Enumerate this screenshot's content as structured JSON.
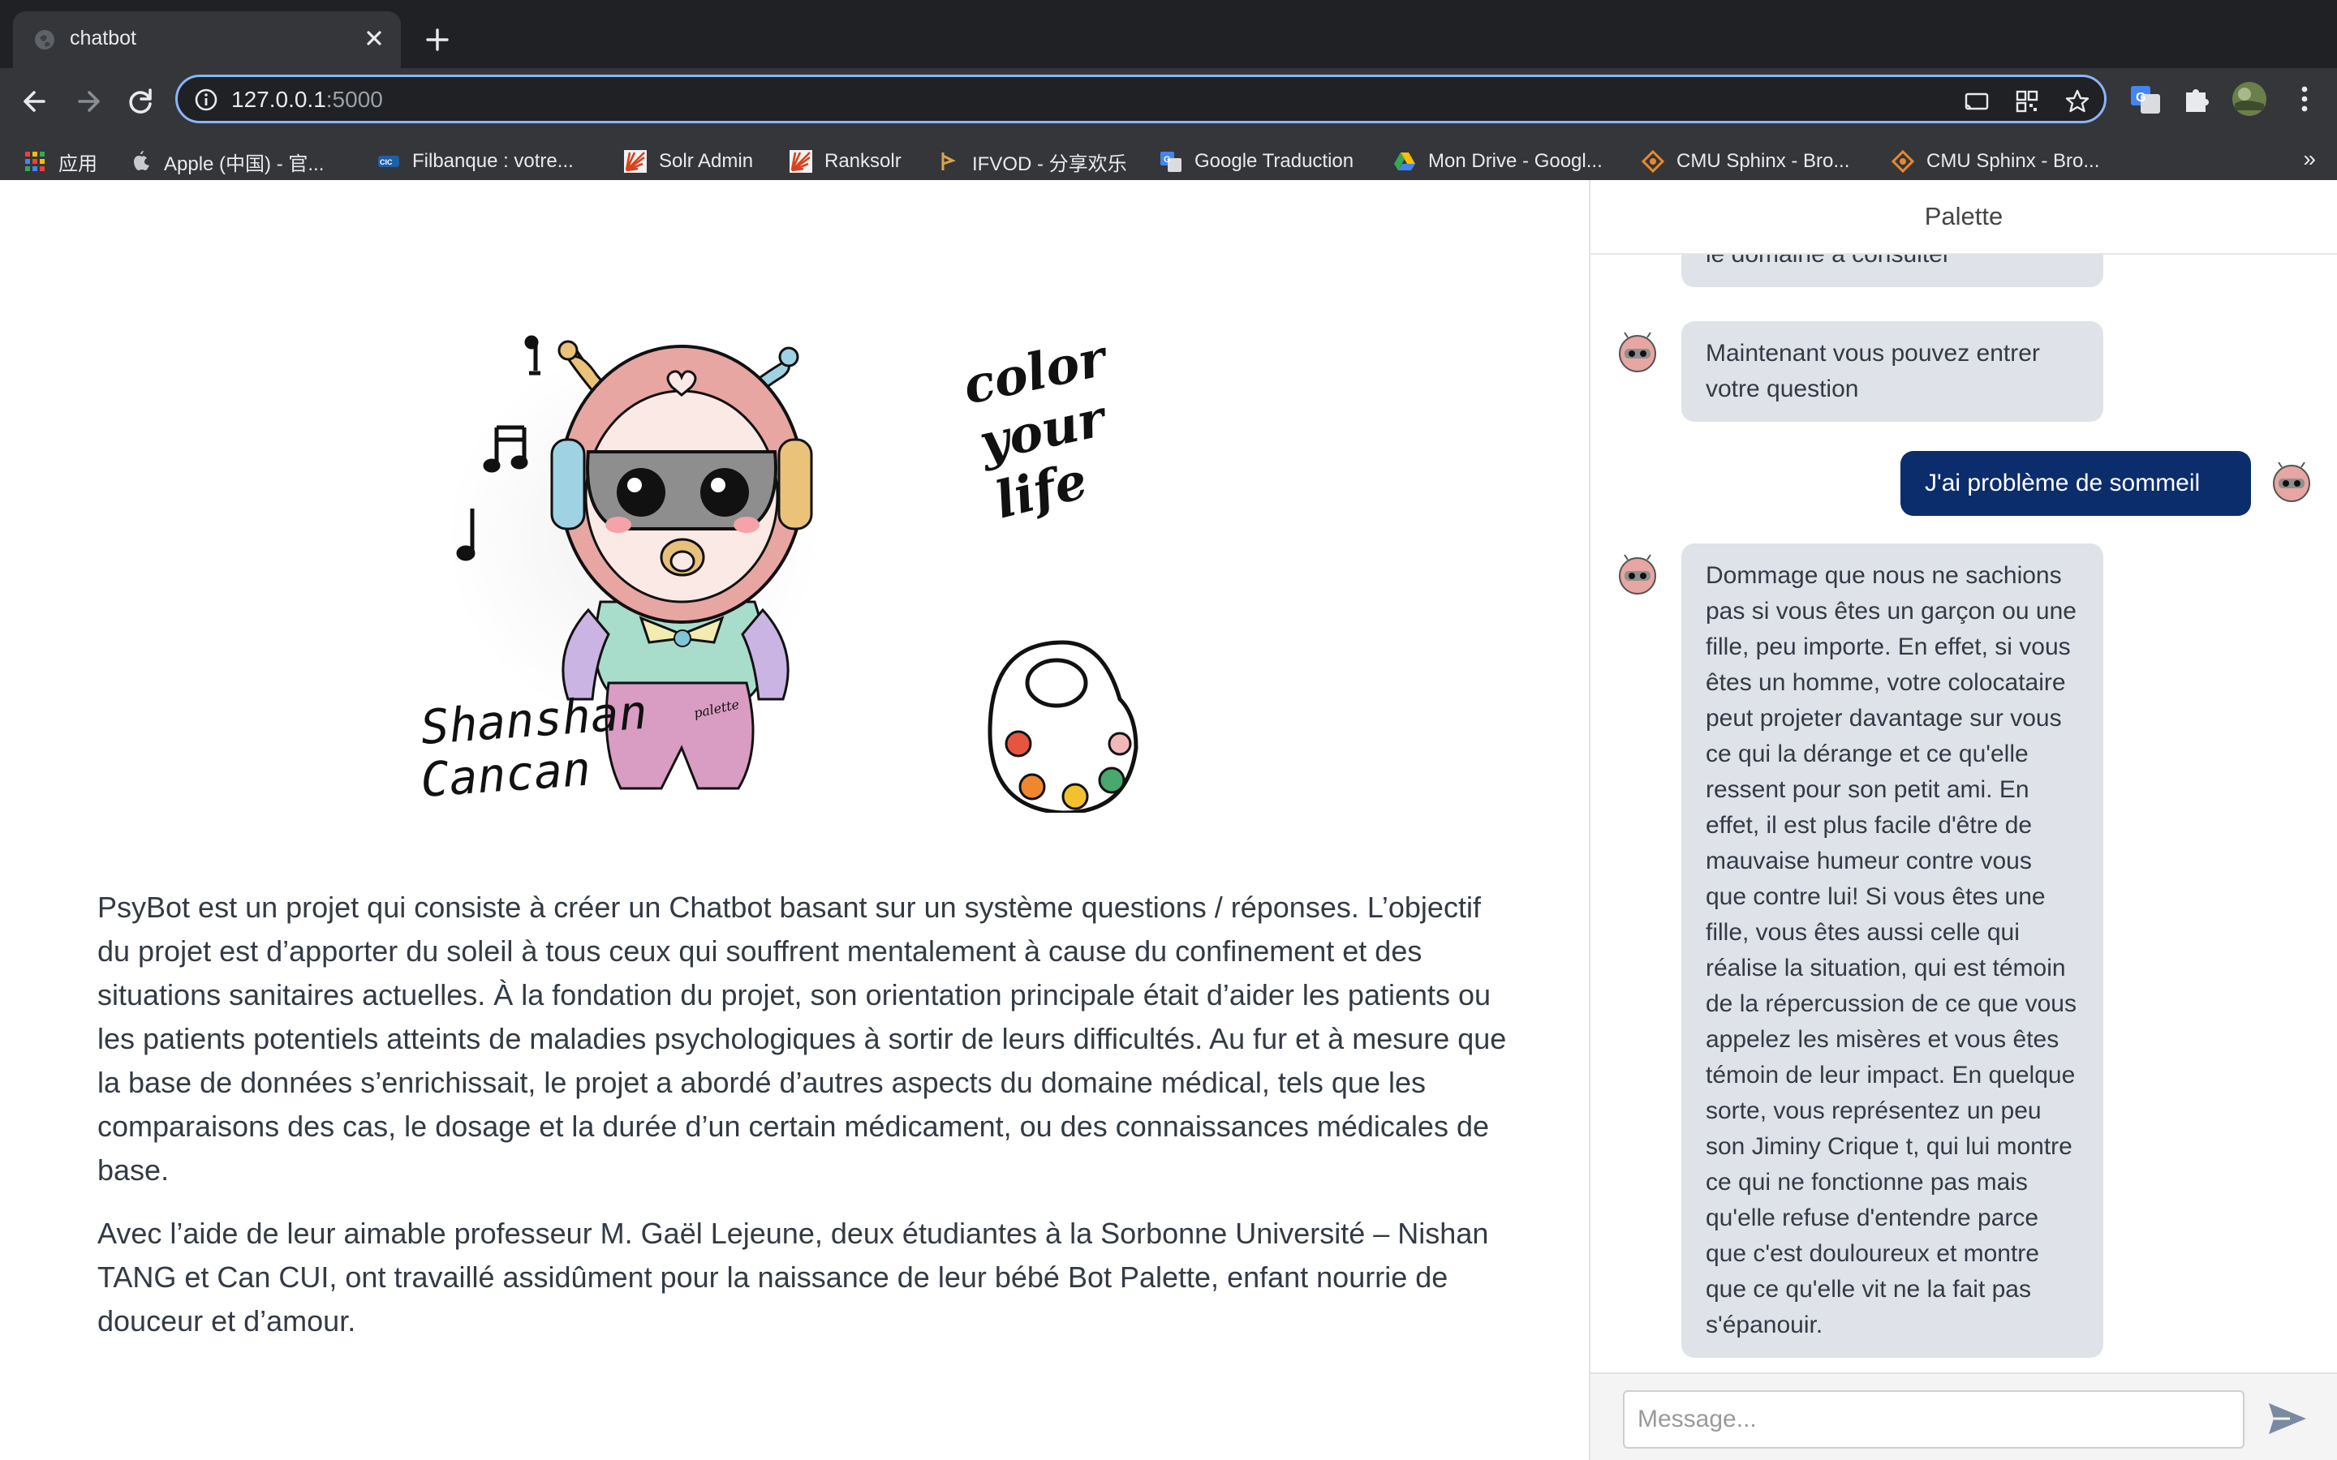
{
  "browser": {
    "tab_title": "chatbot",
    "url_host": "127.0.0.1",
    "url_port": ":5000",
    "bookmarks": [
      {
        "label": "应用",
        "icon": "apps-grid-icon"
      },
      {
        "label": "Apple (中国) - 官...",
        "icon": "apple-icon"
      },
      {
        "label": "Filbanque : votre...",
        "icon": "cic-icon"
      },
      {
        "label": "Solr Admin",
        "icon": "solr-icon"
      },
      {
        "label": "Ranksolr",
        "icon": "solr-icon"
      },
      {
        "label": "IFVOD - 分享欢乐",
        "icon": "ifvod-icon"
      },
      {
        "label": "Google Traduction",
        "icon": "google-translate-icon"
      },
      {
        "label": "Mon Drive - Googl...",
        "icon": "google-drive-icon"
      },
      {
        "label": "CMU Sphinx - Bro...",
        "icon": "sphinx-icon"
      },
      {
        "label": "CMU Sphinx - Bro...",
        "icon": "sphinx-icon"
      }
    ],
    "bookmarks_overflow": "»"
  },
  "page": {
    "illustration": {
      "doodle_text": "color your life",
      "signature": [
        "Shanshan",
        "Cancan"
      ],
      "shirt_text": "palette"
    },
    "intro_paragraphs": [
      "PsyBot est un projet qui consiste à créer un Chatbot basant sur un système questions / réponses. L’objectif du projet est d’apporter du soleil à tous ceux qui souffrent mentalement à cause du confinement et des situations sanitaires actuelles. À la fondation du projet, son orientation principale était d’aider les patients ou les patients potentiels atteints de maladies psychologiques à sortir de leurs difficultés. Au fur et à mesure que la base de données s’enrichissait, le projet a abordé d’autres aspects du domaine médical, tels que les comparaisons des cas, le dosage et la durée d’un certain médicament, ou des connaissances médicales de base.",
      "Avec l’aide de leur aimable professeur M. Gaël Lejeune, deux étudiantes à la Sorbonne Université – Nishan TANG et Can CUI, ont travaillé assidûment pour la naissance de leur bébé Bot Palette, enfant nourrie de douceur et d’amour."
    ]
  },
  "chat": {
    "title": "Palette",
    "messages": [
      {
        "from": "bot",
        "text": "le domaine à consulter"
      },
      {
        "from": "bot",
        "text": "Maintenant vous pouvez entrer votre question"
      },
      {
        "from": "user",
        "text": "J'ai problème de sommeil"
      },
      {
        "from": "bot",
        "text": "Dommage que nous ne sachions pas si vous êtes un garçon ou une fille, peu importe. En effet, si vous êtes un homme, votre colocataire peut projeter davantage sur vous ce qui la dérange et ce qu'elle ressent pour son petit ami. En effet, il est plus facile d'être de mauvaise humeur contre vous que contre lui! Si vous êtes une fille, vous êtes aussi celle qui réalise la situation, qui est témoin de la répercussion de ce que vous appelez les misères et vous êtes témoin de leur impact. En quelque sorte, vous représentez un peu son Jiminy Crique t, qui lui montre ce qui ne fonctionne pas mais qu'elle refuse d'entendre parce que c'est douloureux et montre que ce qu'elle vit ne la fait pas s'épanouir."
      }
    ],
    "input_placeholder": "Message..."
  },
  "colors": {
    "chrome_dark": "#202124",
    "chrome_toolbar": "#35363a",
    "bot_bubble": "#dfe2e9",
    "user_bubble": "#0b2d6b",
    "body_text": "#333a45"
  }
}
